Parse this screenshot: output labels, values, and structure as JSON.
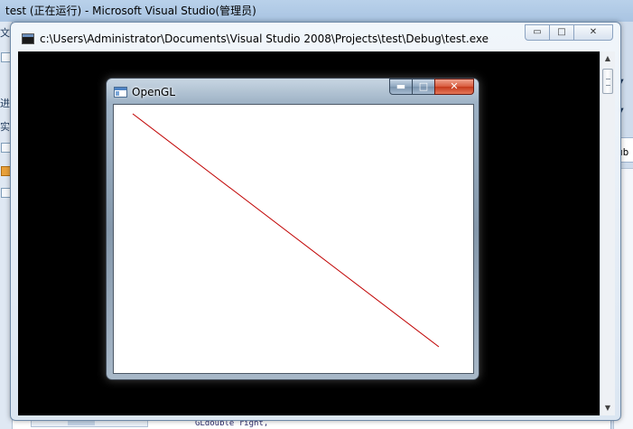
{
  "vs": {
    "title": "test (正在运行) - Microsoft Visual Studio(管理员)",
    "left_glyphs": [
      "文",
      "进",
      "实"
    ],
    "right_code_fragment": "ub",
    "bottom_scroll_label": "III",
    "bottom_code_line": "GLdouble right,"
  },
  "console": {
    "title": "c:\\Users\\Administrator\\Documents\\Visual Studio 2008\\Projects\\test\\Debug\\test.exe",
    "minimize_glyph": "▭",
    "maximize_glyph": "□",
    "close_glyph": "✕",
    "scroll_up_glyph": "▲",
    "scroll_down_glyph": "▼"
  },
  "opengl": {
    "title": "OpenGL",
    "minimize_glyph": "▬",
    "maximize_glyph": "□",
    "close_glyph": "✕",
    "line": {
      "color": "#c00000"
    }
  },
  "colors": {
    "console_bg": "#000000",
    "gl_client_bg": "#ffffff",
    "close_red": "#c53a1b"
  }
}
